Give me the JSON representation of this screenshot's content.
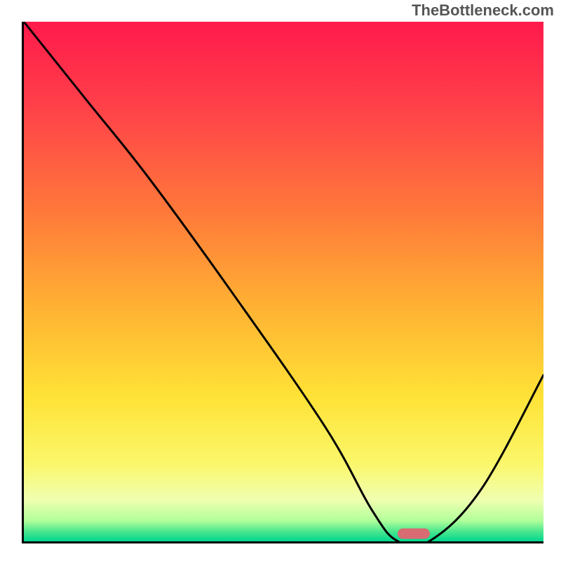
{
  "watermark": "TheBottleneck.com",
  "chart_data": {
    "type": "line",
    "title": "",
    "xlabel": "",
    "ylabel": "",
    "xlim": [
      0,
      100
    ],
    "ylim": [
      0,
      100
    ],
    "grid": false,
    "legend": false,
    "series": [
      {
        "name": "bottleneck-curve",
        "x": [
          0,
          12,
          24,
          40,
          58,
          67,
          72,
          78,
          88,
          100
        ],
        "y": [
          100,
          85,
          70,
          48,
          22,
          6,
          0,
          0,
          10,
          32
        ]
      }
    ],
    "marker": {
      "x": 75,
      "y": 1.5
    },
    "gradient_colors": {
      "top": "#ff1a4b",
      "mid_upper": "#ff7a3a",
      "mid": "#ffe236",
      "mid_lower": "#f0ffb0",
      "bottom": "#00d68f"
    },
    "border_color": "#000000",
    "curve_color": "#000000",
    "marker_color": "#d96b72"
  }
}
